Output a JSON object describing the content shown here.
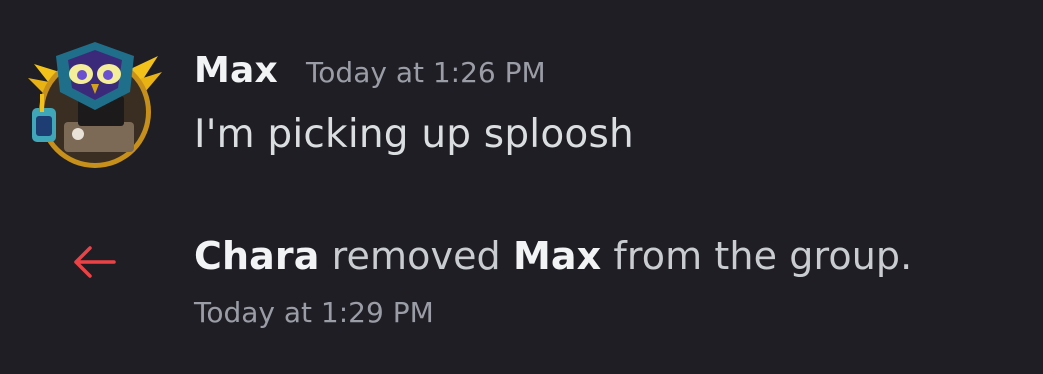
{
  "message": {
    "username": "Max",
    "timestamp": "Today at 1:26 PM",
    "content": "I'm picking up sploosh",
    "avatar": "owl-mascot-avatar"
  },
  "system_event": {
    "icon": "arrow-left-icon",
    "icon_color": "#ed4245",
    "actor": "Chara",
    "action": " removed ",
    "target": "Max",
    "suffix": " from the group.",
    "timestamp": "Today at 1:29 PM"
  },
  "colors": {
    "background": "#1e1e24",
    "username": "#f2f3f5",
    "timestamp": "#9a9ca6",
    "text": "#dbdee1",
    "leave_arrow": "#ed4245"
  }
}
